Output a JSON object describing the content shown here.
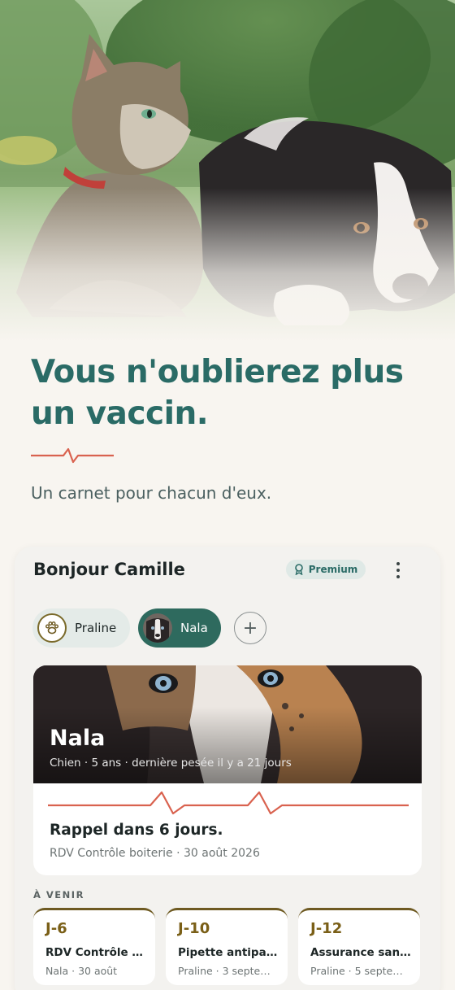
{
  "hero": {
    "headline": "Vous n'oublierez plus un vaccin.",
    "subtitle": "Un carnet pour chacun d'eux."
  },
  "app": {
    "greeting": "Bonjour Camille",
    "premium_label": "Premium",
    "pets": [
      {
        "name": "Praline",
        "selected": false,
        "avatar_icon": "paw-icon"
      },
      {
        "name": "Nala",
        "selected": true,
        "avatar_icon": "dog-photo"
      }
    ],
    "add_pet_symbol": "+",
    "selected_pet": {
      "name": "Nala",
      "meta": "Chien · 5 ans · dernière pesée il y a 21 jours",
      "reminder_title": "Rappel dans 6 jours.",
      "reminder_detail": "RDV Contrôle boiterie · 30 août 2026"
    },
    "upcoming_heading": "À VENIR",
    "upcoming": [
      {
        "countdown": "J-6",
        "title": "RDV Contrôle b…",
        "sub": "Nala · 30 août"
      },
      {
        "countdown": "J-10",
        "title": "Pipette antipara…",
        "sub": "Praline · 3 septem…"
      },
      {
        "countdown": "J-12",
        "title": "Assurance santé…",
        "sub": "Praline · 5 septem…"
      }
    ]
  },
  "colors": {
    "background": "#f8f5f0",
    "brand_teal": "#2a6b66",
    "accent_coral": "#d9624f",
    "chip_selected": "#2e6a5e",
    "event_accent": "#7a5f17"
  }
}
